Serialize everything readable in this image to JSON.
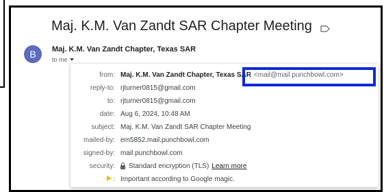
{
  "email": {
    "subject": "Maj. K.M. Van Zandt SAR Chapter Meeting",
    "sender_name": "Maj. K.M. Van Zandt Chapter, Texas SAR",
    "to_me": "to me",
    "avatar_letter": "B",
    "avatar_color": "#5c6bc0"
  },
  "details": {
    "from_label": "from:",
    "from_name": "Maj. K.M. Van Zandt Chapter, Texas SAR",
    "from_email": "<mail@mail.punchbowl.com>",
    "reply_to_label": "reply-to:",
    "reply_to": "rjturner0815@gmail.com",
    "to_label": "to:",
    "to": "rjturner0815@gmail.com",
    "date_label": "date:",
    "date": "Aug 6, 2024, 10:48 AM",
    "subject_label": "subject:",
    "subject": "Maj. K.M. Van Zandt SAR Chapter Meeting",
    "mailed_by_label": "mailed-by:",
    "mailed_by": "em5852.mail.punchbowl.com",
    "signed_by_label": "signed-by:",
    "signed_by": "mail.punchbowl.com",
    "security_label": "security:",
    "security": "Standard encryption (TLS)",
    "learn_more": "Learn more",
    "importance_label": ":",
    "importance": "Important according to Google magic."
  },
  "colors": {
    "highlight": "#0b2bd8",
    "importance_marker": "#f4b400"
  }
}
